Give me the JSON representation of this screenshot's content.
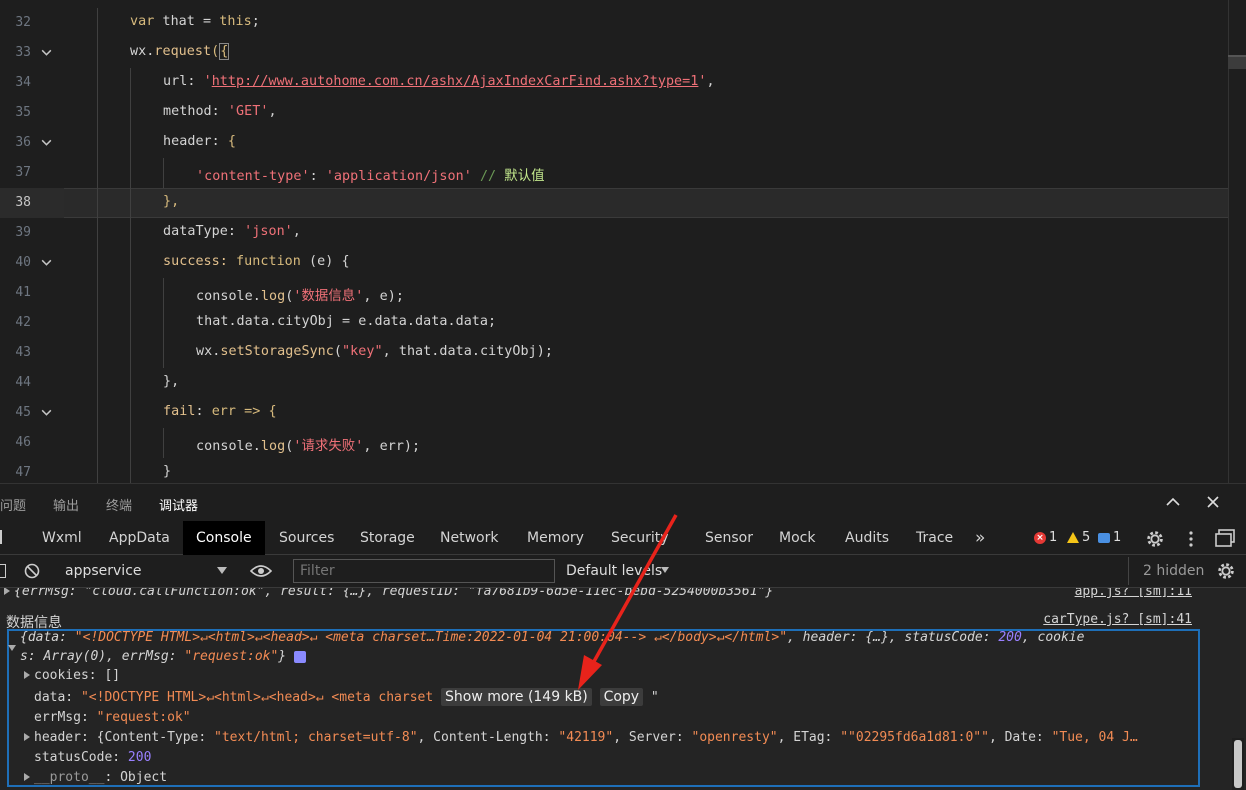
{
  "editor": {
    "lines": [
      {
        "num": "32"
      },
      {
        "num": "33"
      },
      {
        "num": "34"
      },
      {
        "num": "35"
      },
      {
        "num": "36"
      },
      {
        "num": "37"
      },
      {
        "num": "38"
      },
      {
        "num": "39"
      },
      {
        "num": "40"
      },
      {
        "num": "41"
      },
      {
        "num": "42"
      },
      {
        "num": "43"
      },
      {
        "num": "44"
      },
      {
        "num": "45"
      },
      {
        "num": "46"
      },
      {
        "num": "47"
      }
    ],
    "code": {
      "l32_var": "var",
      "l32_rest": " that = ",
      "l32_this": "this",
      "l32_end": ";",
      "l33_obj": "wx.",
      "l33_fn": "request",
      "l33_paren": "(",
      "l33_brace": "{",
      "l34_key": "url: ",
      "l34_q1": "'",
      "l34_url": "http://www.autohome.com.cn/ashx/AjaxIndexCarFind.ashx?type=1",
      "l34_q2": "'",
      "l34_end": ",",
      "l35_key": "method: ",
      "l35_val": "'GET'",
      "l35_end": ",",
      "l36_key": "header: ",
      "l36_brace": "{",
      "l37_key": "'content-type'",
      "l37_colon": ": ",
      "l37_val": "'application/json'",
      "l37_comment": " // ",
      "l37_comment_cn": "默认值",
      "l38_text": "},",
      "l39_key": "dataType: ",
      "l39_val": "'json'",
      "l39_end": ",",
      "l40_key": "success: ",
      "l40_fn": "function",
      "l40_rest": " (e) {",
      "l41_obj": "console.",
      "l41_fn": "log",
      "l41_open": "(",
      "l41_str": "'数据信息'",
      "l41_rest": ", e);",
      "l42_text": "that.data.cityObj = e.data.data.data;",
      "l43_obj": "wx.",
      "l43_fn": "setStorageSync",
      "l43_open": "(",
      "l43_str": "\"key\"",
      "l43_rest": ", that.data.cityObj);",
      "l44_text": "},",
      "l45_key": "fail",
      "l45_colon": ": ",
      "l45_err": "err",
      "l45_arrow": " => {",
      "l46_obj": "console.",
      "l46_fn": "log",
      "l46_open": "(",
      "l46_str": "'请求失败'",
      "l46_rest": ", err);",
      "l47_text": "}"
    }
  },
  "panel_tabs": {
    "problems": "问题",
    "output": "输出",
    "terminal": "终端",
    "debugger": "调试器"
  },
  "devtools_tabs": [
    "Wxml",
    "AppData",
    "Console",
    "Sources",
    "Storage",
    "Network",
    "Memory",
    "Security",
    "Sensor",
    "Mock",
    "Audits",
    "Trace"
  ],
  "devtools_more": "»",
  "badges": {
    "errors": "1",
    "warnings": "5",
    "messages": "1"
  },
  "toolbar": {
    "context": "appservice",
    "filter_placeholder": "Filter",
    "levels": "Default levels",
    "hidden": "2 hidden"
  },
  "console": {
    "row1_text": "{errMsg: \"cloud.callFunction:ok\", result: {…}, requestID: \"fa7681b9-6d5e-11ec-bebd-5254000b3561\"}",
    "row1_src": "app.js? [sm]:11",
    "row2_label": "数据信息",
    "row2_src": "carType.js? [sm]:41",
    "summary_open": "{data: ",
    "summary_data": "\"<!DOCTYPE HTML>↵<html>↵<head>↵    <meta charset…Time:2022-01-04 21:00:04-->    ↵</body>↵</html>\"",
    "summary_mid": ", header: {…}, statusCode: ",
    "summary_code": "200",
    "summary_end": ", cookie",
    "summary_line2": "s: Array(0), errMsg: ",
    "summary_errmsg": "\"request:ok\"",
    "summary_close": "}",
    "cookies_key": "cookies: ",
    "cookies_val": "[]",
    "data_key": "data: ",
    "data_val": "\"<!DOCTYPE HTML>↵<html>↵<head>↵    <meta charset",
    "show_more": "Show more (149 kB)",
    "copy": "Copy",
    "data_tail": "\"",
    "errmsg_key": "errMsg: ",
    "errmsg_val": "\"request:ok\"",
    "header_key": "header: ",
    "header_val_open": "{Content-Type: ",
    "header_ct": "\"text/html; charset=utf-8\"",
    "header_cl_key": ", Content-Length: ",
    "header_cl": "\"42119\"",
    "header_srv_key": ", Server: ",
    "header_srv": "\"openresty\"",
    "header_etag_key": ", ETag: ",
    "header_etag": "\"\"02295fd6a1d81:0\"\"",
    "header_date_key": ", Date: ",
    "header_date": "\"Tue, 04 J…",
    "status_key": "statusCode: ",
    "status_val": "200",
    "proto_key": "__proto__",
    "proto_val": ": Object"
  },
  "colors": {
    "accent": "#1e6fb8",
    "annotation": "#e8231b",
    "error": "#e53935",
    "warning": "#f5c518"
  }
}
